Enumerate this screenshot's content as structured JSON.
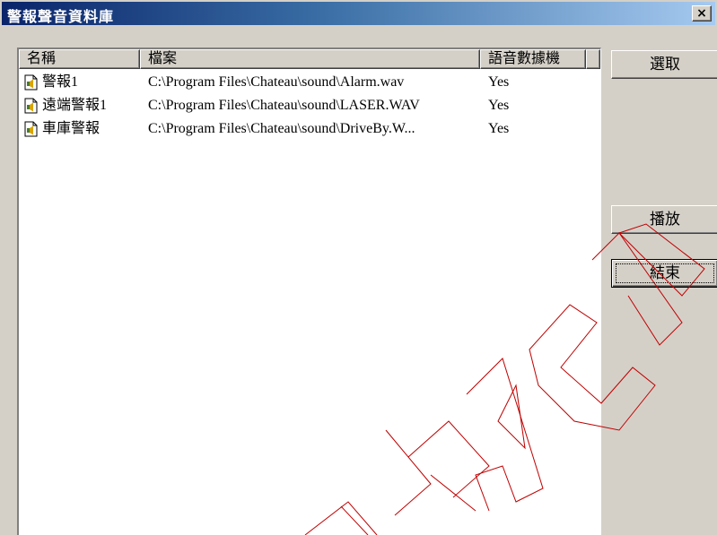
{
  "window": {
    "title": "警報聲音資料庫",
    "close_label": "×"
  },
  "list": {
    "columns": [
      "名稱",
      "檔案",
      "語音數據機"
    ],
    "rows": [
      {
        "name": "警報1",
        "file": "C:\\Program Files\\Chateau\\sound\\Alarm.wav",
        "modem": "Yes",
        "icon": "sound-file-icon"
      },
      {
        "name": "遠端警報1",
        "file": "C:\\Program Files\\Chateau\\sound\\LASER.WAV",
        "modem": "Yes",
        "icon": "sound-file-icon"
      },
      {
        "name": "車庫警報",
        "file": "C:\\Program Files\\Chateau\\sound\\DriveBy.W...",
        "modem": "Yes",
        "icon": "sound-file-icon"
      }
    ]
  },
  "buttons": {
    "select": "選取",
    "play": "播放",
    "end": "結束"
  },
  "watermark": {
    "text": "CHATEAU",
    "color": "#c00000"
  }
}
